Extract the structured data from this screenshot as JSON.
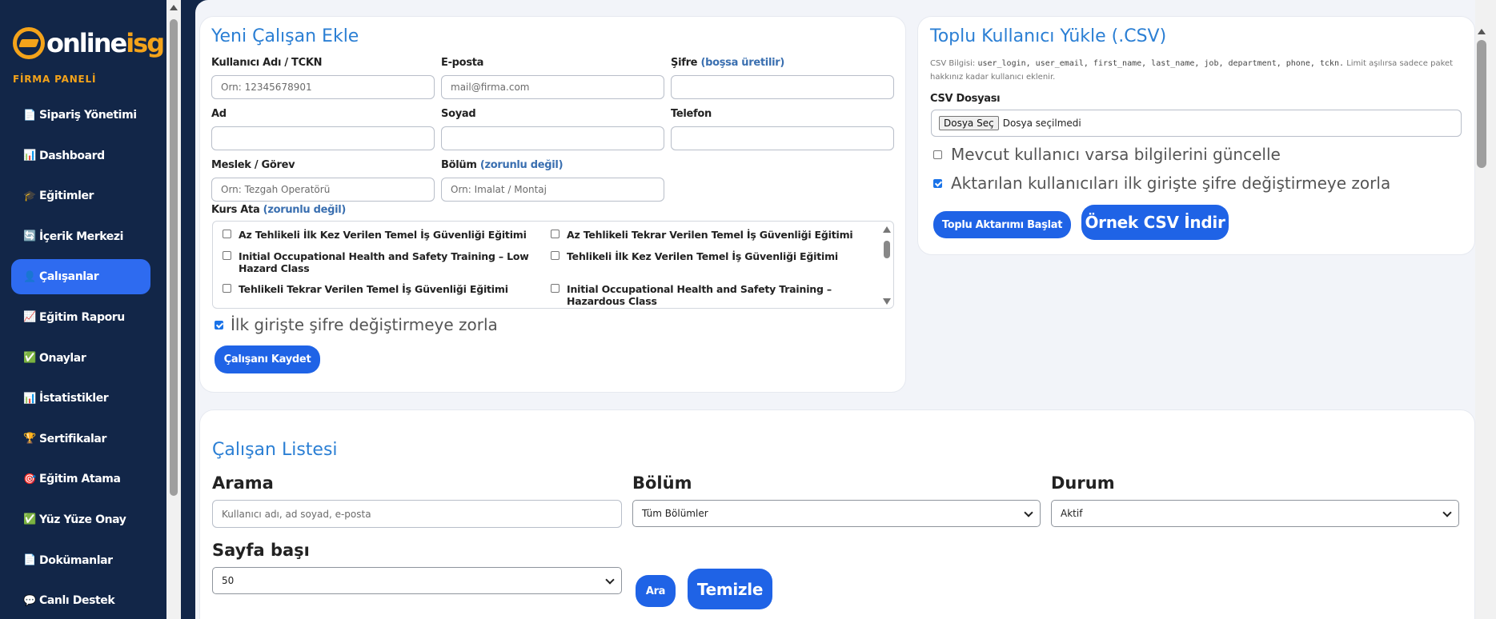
{
  "brand": {
    "logo_part1": "online",
    "logo_part2": "isg",
    "panel_label": "FİRMA PANELİ"
  },
  "sidebar": {
    "items": [
      {
        "icon": "📄",
        "icon_name": "document-icon",
        "label": "Sipariş Yönetimi",
        "active": false
      },
      {
        "icon": "📊",
        "icon_name": "bar-chart-icon",
        "label": "Dashboard",
        "active": false
      },
      {
        "icon": "🎓",
        "icon_name": "graduation-cap-icon",
        "label": "Eğitimler",
        "active": false
      },
      {
        "icon": "🔄",
        "icon_name": "refresh-icon",
        "label": "İçerik Merkezi",
        "active": false
      },
      {
        "icon": "👤",
        "icon_name": "user-icon",
        "label": "Çalışanlar",
        "active": true
      },
      {
        "icon": "📈",
        "icon_name": "trend-chart-icon",
        "label": "Eğitim Raporu",
        "active": false
      },
      {
        "icon": "✅",
        "icon_name": "check-icon",
        "label": "Onaylar",
        "active": false
      },
      {
        "icon": "📊",
        "icon_name": "stats-icon",
        "label": "İstatistikler",
        "active": false
      },
      {
        "icon": "🏆",
        "icon_name": "trophy-icon",
        "label": "Sertifikalar",
        "active": false
      },
      {
        "icon": "🎯",
        "icon_name": "target-icon",
        "label": "Eğitim Atama",
        "active": false
      },
      {
        "icon": "✅",
        "icon_name": "check-icon",
        "label": "Yüz Yüze Onay",
        "active": false
      },
      {
        "icon": "📄",
        "icon_name": "document-icon",
        "label": "Dokümanlar",
        "active": false
      },
      {
        "icon": "💬",
        "icon_name": "chat-icon",
        "label": "Canlı Destek",
        "active": false
      }
    ]
  },
  "add_employee": {
    "title": "Yeni Çalışan Ekle",
    "username_label": "Kullanıcı Adı / TCKN",
    "username_placeholder": "Orn: 12345678901",
    "email_label": "E-posta",
    "email_placeholder": "mail@firma.com",
    "password_label": "Şifre",
    "password_hint": "(boşsa üretilir)",
    "password_value": "",
    "first_name_label": "Ad",
    "first_name_value": "",
    "last_name_label": "Soyad",
    "last_name_value": "",
    "phone_label": "Telefon",
    "phone_value": "",
    "job_label": "Meslek / Görev",
    "job_placeholder": "Orn: Tezgah Operatörü",
    "department_label": "Bölüm",
    "department_hint": "(zorunlu değil)",
    "department_placeholder": "Orn: Imalat / Montaj",
    "course_label": "Kurs Ata",
    "course_hint": "(zorunlu değil)",
    "courses": [
      {
        "label": "Az Tehlikeli İlk Kez Verilen Temel İş Güvenliği Eğitimi",
        "checked": false
      },
      {
        "label": "Az Tehlikeli Tekrar Verilen Temel İş Güvenliği Eğitimi",
        "checked": false
      },
      {
        "label": "Initial Occupational Health and Safety Training – Low Hazard Class",
        "checked": false
      },
      {
        "label": "Tehlikeli İlk Kez Verilen Temel İş Güvenliği Eğitimi",
        "checked": false
      },
      {
        "label": "Tehlikeli Tekrar Verilen Temel İş Güvenliği Eğitimi",
        "checked": false
      },
      {
        "label": "Initial Occupational Health and Safety Training – Hazardous Class",
        "checked": false
      }
    ],
    "force_password_label": "İlk girişte şifre değiştirmeye zorla",
    "force_password_checked": true,
    "save_button": "Çalışanı Kaydet"
  },
  "bulk_upload": {
    "title": "Toplu Kullanıcı Yükle (.CSV)",
    "info_prefix": "CSV Bilgisi:",
    "info_fields": "user_login, user_email, first_name, last_name, job, department, phone, tckn.",
    "info_suffix": "Limit aşılırsa sadece paket hakkınız kadar kullanıcı eklenir.",
    "file_label": "CSV Dosyası",
    "file_button": "Dosya Seç",
    "file_status": "Dosya seçilmedi",
    "update_existing_label": "Mevcut kullanıcı varsa bilgilerini güncelle",
    "update_existing_checked": false,
    "force_password_label": "Aktarılan kullanıcıları ilk girişte şifre değiştirmeye zorla",
    "force_password_checked": true,
    "start_button": "Toplu Aktarımı Başlat",
    "sample_button": "Örnek CSV İndir"
  },
  "employee_list": {
    "title": "Çalışan Listesi",
    "search_label": "Arama",
    "search_placeholder": "Kullanıcı adı, ad soyad, e-posta",
    "department_label": "Bölüm",
    "department_value": "Tüm Bölümler",
    "status_label": "Durum",
    "status_value": "Aktif",
    "per_page_label": "Sayfa başı",
    "per_page_value": "50",
    "search_button": "Ara",
    "clear_button": "Temizle"
  },
  "colors": {
    "sidebar_bg": "#122648",
    "accent": "#1f63e6",
    "title_blue": "#2b7fd4",
    "brand_orange": "#f4a31a"
  }
}
